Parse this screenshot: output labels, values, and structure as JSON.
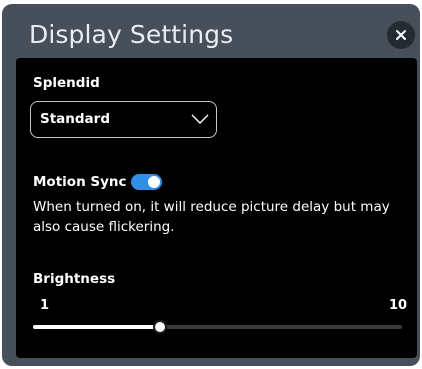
{
  "dialog": {
    "title": "Display Settings",
    "close_icon": "close-icon"
  },
  "splendid": {
    "label": "Splendid",
    "selected": "Standard",
    "dropdown_icon": "chevron-down-icon"
  },
  "motion_sync": {
    "label": "Motion Sync",
    "enabled": true,
    "description": "When turned on, it will reduce picture delay but may also cause flickering."
  },
  "brightness": {
    "label": "Brightness",
    "min_label": "1",
    "max_label": "10",
    "min": 1,
    "max": 10,
    "value": 4.1
  },
  "colors": {
    "accent": "#2f8fe6",
    "panel": "#000000",
    "frame": "#474f5a"
  }
}
